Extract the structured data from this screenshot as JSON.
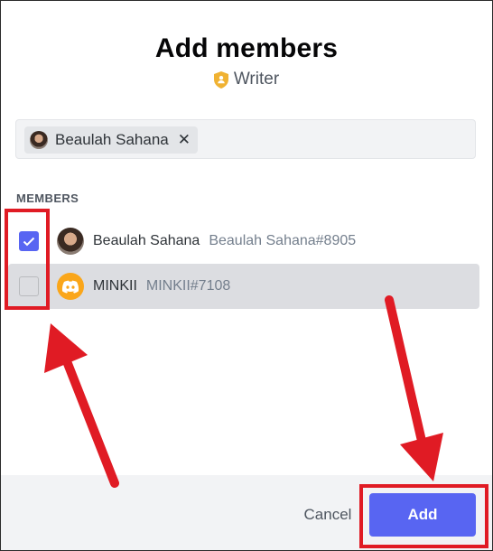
{
  "dialog": {
    "title": "Add members",
    "role_name": "Writer",
    "role_icon": "shield-person-icon",
    "role_color": "#f0b232"
  },
  "search": {
    "chips": [
      {
        "label": "Beaulah Sahana",
        "close_symbol": "✕",
        "avatar": "photo"
      }
    ]
  },
  "members": {
    "header": "MEMBERS",
    "list": [
      {
        "name": "Beaulah Sahana",
        "tag": "Beaulah Sahana#8905",
        "checked": true,
        "avatar": "photo"
      },
      {
        "name": "MINKII",
        "tag": "MINKII#7108",
        "checked": false,
        "avatar": "discord-logo",
        "hovered": true
      }
    ]
  },
  "footer": {
    "cancel_label": "Cancel",
    "add_label": "Add"
  },
  "colors": {
    "accent": "#5865f2",
    "annotation": "#e01b24",
    "discord_avatar": "#faa61a"
  }
}
